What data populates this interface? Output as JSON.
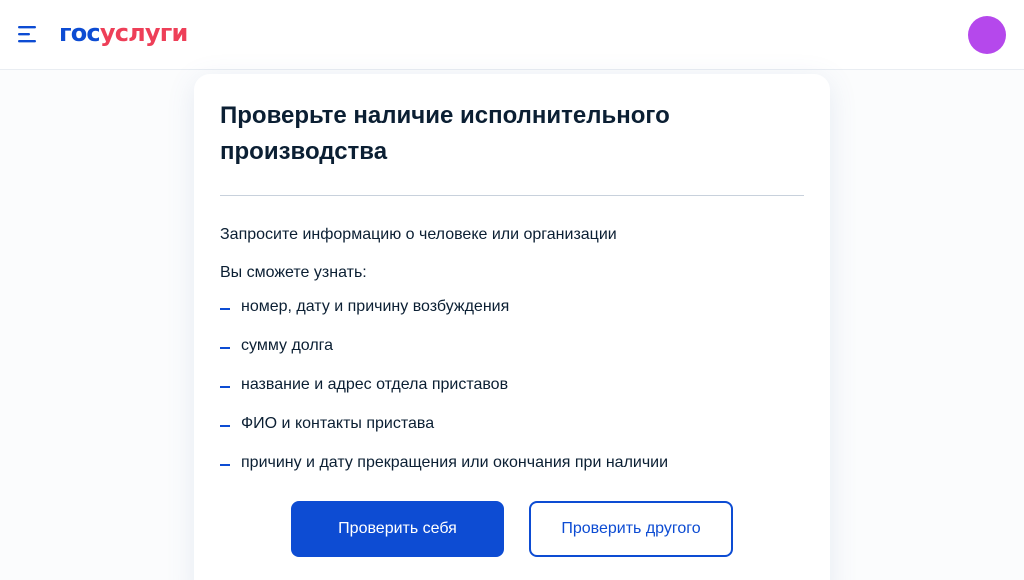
{
  "header": {
    "logo": {
      "part1": "гос",
      "part2": "услуги"
    },
    "menu_icon": "hamburger-menu-icon",
    "avatar_color": "#b548ec"
  },
  "card": {
    "title": "Проверьте наличие исполнительного производства",
    "intro": "Запросите информацию о человеке или организации",
    "subtitle": "Вы сможете узнать:",
    "items": [
      {
        "label": "номер, дату и причину возбуждения"
      },
      {
        "label": "сумму долга"
      },
      {
        "label": "название и адрес отдела приставов"
      },
      {
        "label": "ФИО и контакты пристава"
      },
      {
        "label": "причину и дату прекращения или окончания при наличии"
      }
    ],
    "buttons": {
      "primary": "Проверить себя",
      "secondary": "Проверить другого"
    }
  },
  "colors": {
    "brand_blue": "#0d4cd3",
    "brand_red": "#ee3f58",
    "text_dark": "#0b1f33",
    "divider": "#c8d1dc"
  }
}
